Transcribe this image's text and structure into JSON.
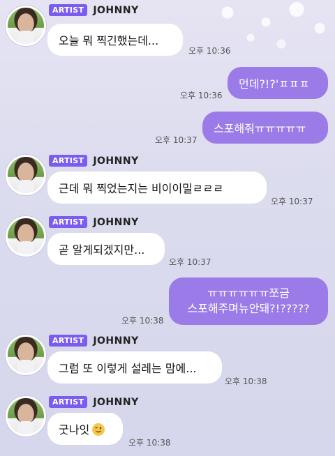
{
  "messages": [
    {
      "sender_badge": "ARTIST",
      "sender_name": "JOHNNY",
      "text": "오늘 뭐 찍긴했는데...",
      "time": "오후 10:36"
    },
    {
      "text": "먼데?!?'ㅍㅍㅍ",
      "time": "오후 10:36"
    },
    {
      "text": "스포해줘ㅠㅠㅠㅠㅠ",
      "time": "오후 10:37"
    },
    {
      "sender_badge": "ARTIST",
      "sender_name": "JOHNNY",
      "text": "근데 뭐 찍었는지는 비이이밀ㄹㄹㄹ",
      "time": "오후 10:37"
    },
    {
      "sender_badge": "ARTIST",
      "sender_name": "JOHNNY",
      "text": "곧 알게되겠지만...",
      "time": "오후 10:37"
    },
    {
      "text_line1": "ㅠㅠㅠㅠㅠㅠ쪼금",
      "text_line2": "스포해주며뉴안돼?!?????",
      "time": "오후 10:38"
    },
    {
      "sender_badge": "ARTIST",
      "sender_name": "JOHNNY",
      "text": "그럼 또 이렇게 설레는 맘에...",
      "time": "오후 10:38"
    },
    {
      "sender_badge": "ARTIST",
      "sender_name": "JOHNNY",
      "text": "굿나잇",
      "emoji": "winking-face",
      "time": "오후 10:38"
    }
  ],
  "colors": {
    "badge": "#7b5cf0",
    "outgoing_bubble": "#9b7be8",
    "incoming_bubble": "#ffffff"
  }
}
